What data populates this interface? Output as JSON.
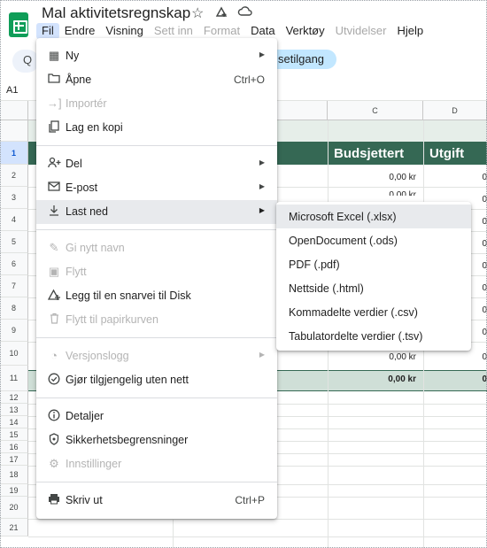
{
  "window": {
    "title": "Mal aktivitetsregnskap",
    "icons": [
      "star-icon",
      "move-to-drive-icon",
      "cloud-status-icon"
    ]
  },
  "menubar": {
    "items": [
      {
        "label": "Fil",
        "state": "active"
      },
      {
        "label": "Endre",
        "state": "normal"
      },
      {
        "label": "Visning",
        "state": "normal"
      },
      {
        "label": "Sett inn",
        "state": "disabled"
      },
      {
        "label": "Format",
        "state": "disabled"
      },
      {
        "label": "Data",
        "state": "normal"
      },
      {
        "label": "Verktøy",
        "state": "normal"
      },
      {
        "label": "Utvidelser",
        "state": "disabled"
      },
      {
        "label": "Hjelp",
        "state": "normal"
      }
    ]
  },
  "toolbar": {
    "access_label": "setilgang"
  },
  "namebox": "A1",
  "sheet": {
    "columns": [
      "C",
      "D"
    ],
    "headers": [
      "Budsjettert",
      "Utgift"
    ],
    "rows": [
      "1",
      "2",
      "3",
      "4",
      "5",
      "6",
      "7",
      "8",
      "9",
      "10",
      "11",
      "12",
      "13",
      "14",
      "15",
      "16",
      "17",
      "18",
      "19",
      "20",
      "21"
    ],
    "values_c": [
      "0,00 kr",
      "0,00 kr",
      "0,00 kr"
    ],
    "total_c": "0,00 kr",
    "values_d": [
      "0",
      "0",
      "0",
      "0",
      "0",
      "0",
      "0",
      "0",
      "0"
    ],
    "total_d": "0"
  },
  "file_menu": {
    "items": [
      {
        "icon": "new-icon",
        "label": "Ny",
        "submenu": true
      },
      {
        "icon": "folder-open-icon",
        "label": "Åpne",
        "shortcut": "Ctrl+O"
      },
      {
        "icon": "import-icon",
        "label": "Importér",
        "disabled": true
      },
      {
        "icon": "copy-icon",
        "label": "Lag en kopi"
      },
      {
        "icon": "share-icon",
        "label": "Del",
        "submenu": true
      },
      {
        "icon": "email-icon",
        "label": "E-post",
        "submenu": true
      },
      {
        "icon": "download-icon",
        "label": "Last ned",
        "submenu": true,
        "highlighted": true
      },
      {
        "icon": "rename-icon",
        "label": "Gi nytt navn",
        "disabled": true
      },
      {
        "icon": "move-icon",
        "label": "Flytt",
        "disabled": true
      },
      {
        "icon": "add-shortcut-icon",
        "label": "Legg til en snarvei til Disk"
      },
      {
        "icon": "trash-icon",
        "label": "Flytt til papirkurven",
        "disabled": true
      },
      {
        "icon": "history-icon",
        "label": "Versjonslogg",
        "submenu": true,
        "disabled": true
      },
      {
        "icon": "offline-icon",
        "label": "Gjør tilgjengelig uten nett"
      },
      {
        "icon": "info-icon",
        "label": "Detaljer"
      },
      {
        "icon": "security-icon",
        "label": "Sikkerhetsbegrensninger"
      },
      {
        "icon": "settings-icon",
        "label": "Innstillinger",
        "disabled": true
      },
      {
        "icon": "print-icon",
        "label": "Skriv ut",
        "shortcut": "Ctrl+P"
      }
    ]
  },
  "download_submenu": {
    "items": [
      {
        "label": "Microsoft Excel (.xlsx)",
        "highlighted": true
      },
      {
        "label": "OpenDocument (.ods)"
      },
      {
        "label": "PDF (.pdf)"
      },
      {
        "label": "Nettside (.html)"
      },
      {
        "label": "Kommadelte verdier (.csv)"
      },
      {
        "label": "Tabulatordelte verdier (.tsv)"
      }
    ]
  },
  "colors": {
    "accent": "#356854",
    "banner": "#e6eee9",
    "highlight": "#e8eaed",
    "logo": "#0f9d58"
  }
}
